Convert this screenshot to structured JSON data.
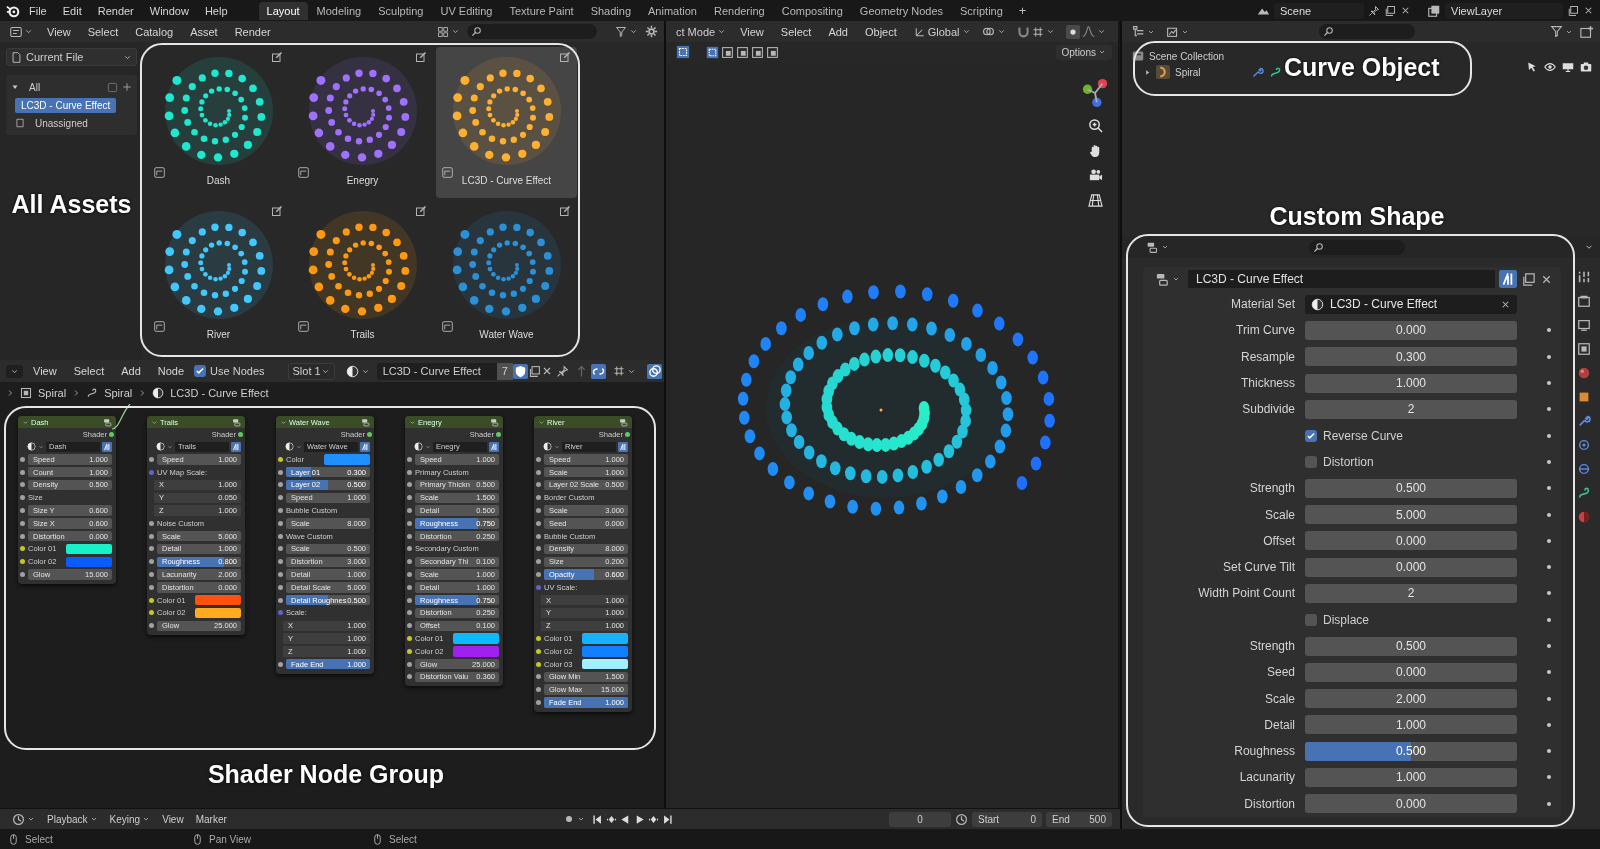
{
  "top_menu": [
    "File",
    "Edit",
    "Render",
    "Window",
    "Help"
  ],
  "workspaces": [
    {
      "label": "Layout",
      "selected": true
    },
    {
      "label": "Modeling",
      "selected": false
    },
    {
      "label": "Sculpting",
      "selected": false
    },
    {
      "label": "UV Editing",
      "selected": false
    },
    {
      "label": "Texture Paint",
      "selected": false
    },
    {
      "label": "Shading",
      "selected": false
    },
    {
      "label": "Animation",
      "selected": false
    },
    {
      "label": "Rendering",
      "selected": false
    },
    {
      "label": "Compositing",
      "selected": false
    },
    {
      "label": "Geometry Nodes",
      "selected": false
    },
    {
      "label": "Scripting",
      "selected": false
    }
  ],
  "add_workspace": "+",
  "scene": "Scene",
  "view_layer": "ViewLayer",
  "asset_browser": {
    "menus": [
      "View",
      "Select",
      "Catalog",
      "Asset",
      "Render"
    ],
    "library": "Current File",
    "catalogs": [
      {
        "label": "All",
        "expanded": true,
        "children": [
          {
            "label": "LC3D - Curve Effect",
            "selected": true
          },
          {
            "label": "Unassigned",
            "selected": false
          }
        ]
      }
    ],
    "assets": [
      {
        "name": "Dash",
        "color": "#1ee8d0",
        "selected": false
      },
      {
        "name": "Enegry",
        "color": "#a070ff",
        "selected": false
      },
      {
        "name": "LC3D - Curve Effect",
        "color": "#ffb030",
        "selected": true
      },
      {
        "name": "River",
        "color": "#40c8ff",
        "selected": false
      },
      {
        "name": "Trails",
        "color": "#ff9a10",
        "selected": false
      },
      {
        "name": "Water Wave",
        "color": "#2a90d8",
        "selected": false
      }
    ],
    "callout": "All Assets"
  },
  "node_editor": {
    "menus": [
      "View",
      "Select",
      "Add",
      "Node"
    ],
    "use_nodes": {
      "label": "Use Nodes",
      "checked": true
    },
    "slot": "Slot 1",
    "material": "LC3D - Curve Effect",
    "users": "7",
    "breadcrumbs": [
      "Spiral",
      "Spiral",
      "LC3D - Curve Effect"
    ],
    "callout": "Shader Node Group",
    "nodes": [
      {
        "title": "Dash",
        "output": "Shader",
        "material": "Dash",
        "rows": [
          {
            "kind": "value",
            "label": "Speed",
            "value": "1.000"
          },
          {
            "kind": "value",
            "label": "Count",
            "value": "1.000"
          },
          {
            "kind": "value",
            "label": "Density",
            "value": "0.500"
          },
          {
            "kind": "section",
            "label": "Size"
          },
          {
            "kind": "value",
            "label": "Size Y",
            "value": "0.600"
          },
          {
            "kind": "value",
            "label": "Size X",
            "value": "0.600"
          },
          {
            "kind": "value",
            "label": "Distortion",
            "value": "0.000"
          },
          {
            "kind": "color",
            "label": "Color 01",
            "color": "#19f0c8"
          },
          {
            "kind": "color",
            "label": "Color 02",
            "color": "#0a5cff"
          },
          {
            "kind": "value",
            "label": "Glow",
            "value": "15.000"
          }
        ]
      },
      {
        "title": "Trails",
        "output": "Shader",
        "material": "Trails",
        "rows": [
          {
            "kind": "value",
            "label": "Speed",
            "value": "1.000"
          },
          {
            "kind": "vector",
            "label": "UV Map Scale:"
          },
          {
            "kind": "component",
            "label": "X",
            "value": "1.000"
          },
          {
            "kind": "component",
            "label": "Y",
            "value": "0.050"
          },
          {
            "kind": "component",
            "label": "Z",
            "value": "1.000"
          },
          {
            "kind": "section",
            "label": "Noise Custom"
          },
          {
            "kind": "value",
            "label": "Scale",
            "value": "5.000"
          },
          {
            "kind": "value",
            "label": "Detail",
            "value": "1.000"
          },
          {
            "kind": "slider",
            "label": "Roughness",
            "value": "0.800",
            "level": 0.8
          },
          {
            "kind": "value",
            "label": "Lacunarity",
            "value": "2.000"
          },
          {
            "kind": "value",
            "label": "Distortion",
            "value": "0.000"
          },
          {
            "kind": "color",
            "label": "Color 01",
            "color": "#ff5010"
          },
          {
            "kind": "color",
            "label": "Color 02",
            "color": "#ffaa20"
          },
          {
            "kind": "value",
            "label": "Glow",
            "value": "25.000"
          }
        ]
      },
      {
        "title": "Water Wave",
        "output": "Shader",
        "material": "Water Wave",
        "rows": [
          {
            "kind": "color",
            "label": "Color",
            "color": "#1e90ff"
          },
          {
            "kind": "slider",
            "label": "Layer 01",
            "value": "0.300",
            "level": 0.3
          },
          {
            "kind": "slider",
            "label": "Layer 02",
            "value": "0.500",
            "level": 0.5
          },
          {
            "kind": "value",
            "label": "Speed",
            "value": "1.000"
          },
          {
            "kind": "section",
            "label": "Bubble Custom"
          },
          {
            "kind": "value",
            "label": "Scale",
            "value": "8.000"
          },
          {
            "kind": "section",
            "label": "Wave Custom"
          },
          {
            "kind": "value",
            "label": "Scale",
            "value": "0.500"
          },
          {
            "kind": "value",
            "label": "Distortion",
            "value": "3.000"
          },
          {
            "kind": "value",
            "label": "Detail",
            "value": "1.000"
          },
          {
            "kind": "value",
            "label": "Detail Scale",
            "value": "5.000"
          },
          {
            "kind": "slider",
            "label": "Detail Roughnes",
            "value": "0.500",
            "level": 0.5
          },
          {
            "kind": "vector",
            "label": "Scale:"
          },
          {
            "kind": "component",
            "label": "X",
            "value": "1.000"
          },
          {
            "kind": "component",
            "label": "Y",
            "value": "1.000"
          },
          {
            "kind": "component",
            "label": "Z",
            "value": "1.000"
          },
          {
            "kind": "slider",
            "label": "Fade End",
            "value": "1.000",
            "level": 1
          }
        ]
      },
      {
        "title": "Enegry",
        "output": "Shader",
        "material": "Enegry",
        "rows": [
          {
            "kind": "value",
            "label": "Speed",
            "value": "1.000"
          },
          {
            "kind": "section",
            "label": "Primary Custom"
          },
          {
            "kind": "value",
            "label": "Primary Thickn",
            "value": "0.500"
          },
          {
            "kind": "value",
            "label": "Scale",
            "value": "1.500"
          },
          {
            "kind": "value",
            "label": "Detail",
            "value": "0.500"
          },
          {
            "kind": "slider",
            "label": "Roughness",
            "value": "0.750",
            "level": 0.75
          },
          {
            "kind": "value",
            "label": "Distortion",
            "value": "0.250"
          },
          {
            "kind": "section",
            "label": "Secondary Custom"
          },
          {
            "kind": "value",
            "label": "Secondary Thi",
            "value": "0.100"
          },
          {
            "kind": "value",
            "label": "Scale",
            "value": "1.000"
          },
          {
            "kind": "value",
            "label": "Detail",
            "value": "1.000"
          },
          {
            "kind": "slider",
            "label": "Roughness",
            "value": "0.750",
            "level": 0.75
          },
          {
            "kind": "value",
            "label": "Distortion",
            "value": "0.250"
          },
          {
            "kind": "value",
            "label": "Offset",
            "value": "0.100"
          },
          {
            "kind": "color",
            "label": "Color 01",
            "color": "#10b8ff"
          },
          {
            "kind": "color",
            "label": "Color 02",
            "color": "#a020f0"
          },
          {
            "kind": "value",
            "label": "Glow",
            "value": "25.000"
          },
          {
            "kind": "value",
            "label": "Distortion Valu",
            "value": "0.360"
          }
        ]
      },
      {
        "title": "River",
        "output": "Shader",
        "material": "River",
        "rows": [
          {
            "kind": "value",
            "label": "Speed",
            "value": "1.000"
          },
          {
            "kind": "value",
            "label": "Scale",
            "value": "1.000"
          },
          {
            "kind": "value",
            "label": "Layer 02 Scale",
            "value": "0.500"
          },
          {
            "kind": "section",
            "label": "Border Custom"
          },
          {
            "kind": "value",
            "label": "Scale",
            "value": "3.000"
          },
          {
            "kind": "value",
            "label": "Seed",
            "value": "0.000"
          },
          {
            "kind": "section",
            "label": "Bubble Custom"
          },
          {
            "kind": "value",
            "label": "Density",
            "value": "8.000"
          },
          {
            "kind": "value",
            "label": "Size",
            "value": "0.200"
          },
          {
            "kind": "slider",
            "label": "Opacity",
            "value": "0.600",
            "level": 0.6
          },
          {
            "kind": "vector",
            "label": "UV Scale:"
          },
          {
            "kind": "component",
            "label": "X",
            "value": "1.000"
          },
          {
            "kind": "component",
            "label": "Y",
            "value": "1.000"
          },
          {
            "kind": "component",
            "label": "Z",
            "value": "1.000"
          },
          {
            "kind": "color",
            "label": "Color 01",
            "color": "#18b0ff"
          },
          {
            "kind": "color",
            "label": "Color 02",
            "color": "#1080ff"
          },
          {
            "kind": "color",
            "label": "Color 03",
            "color": "#a0f0ff"
          },
          {
            "kind": "value",
            "label": "Glow Min",
            "value": "1.500"
          },
          {
            "kind": "value",
            "label": "Glow Max",
            "value": "15.000"
          },
          {
            "kind": "slider",
            "label": "Fade End",
            "value": "1.000",
            "level": 1
          }
        ]
      }
    ]
  },
  "viewport": {
    "mode": "ct Mode",
    "menus": [
      "View",
      "Select",
      "Add",
      "Object"
    ],
    "orientation": "Global",
    "options": "Options"
  },
  "outliner": {
    "collection": "Scene Collection",
    "object": "Spiral",
    "callout": "Curve Object"
  },
  "properties": {
    "title": "Custom Shape",
    "modifier": "LC3D - Curve Effect",
    "rows": [
      {
        "kind": "datablock",
        "label": "Material Set",
        "value": "LC3D - Curve Effect"
      },
      {
        "kind": "value",
        "label": "Trim Curve",
        "value": "0.000"
      },
      {
        "kind": "value",
        "label": "Resample",
        "value": "0.300"
      },
      {
        "kind": "value",
        "label": "Thickness",
        "value": "1.000"
      },
      {
        "kind": "value",
        "label": "Subdivide",
        "value": "2"
      },
      {
        "kind": "checkbox",
        "label": "Reverse Curve",
        "checked": true
      },
      {
        "kind": "checkbox",
        "label": "Distortion",
        "checked": false
      },
      {
        "kind": "value",
        "label": "Strength",
        "value": "0.500"
      },
      {
        "kind": "value",
        "label": "Scale",
        "value": "5.000"
      },
      {
        "kind": "value",
        "label": "Offset",
        "value": "0.000"
      },
      {
        "kind": "value",
        "label": "Set Curve Tilt",
        "value": "0.000"
      },
      {
        "kind": "value",
        "label": "Width Point Count",
        "value": "2"
      },
      {
        "kind": "checkbox",
        "label": "Displace",
        "checked": false
      },
      {
        "kind": "value",
        "label": "Strength",
        "value": "0.500"
      },
      {
        "kind": "value",
        "label": "Seed",
        "value": "0.000"
      },
      {
        "kind": "value",
        "label": "Scale",
        "value": "2.000"
      },
      {
        "kind": "value",
        "label": "Detail",
        "value": "1.000"
      },
      {
        "kind": "slider",
        "label": "Roughness",
        "value": "0.500",
        "level": 0.5
      },
      {
        "kind": "value",
        "label": "Lacunarity",
        "value": "1.000"
      },
      {
        "kind": "value",
        "label": "Distortion",
        "value": "0.000"
      }
    ]
  },
  "timeline": {
    "menus": [
      "Playback",
      "Keying",
      "View",
      "Marker"
    ],
    "frame": "0",
    "start_label": "Start",
    "start": "0",
    "end_label": "End",
    "end": "500"
  },
  "status_bar": [
    "Select",
    "Pan View",
    "Select"
  ]
}
